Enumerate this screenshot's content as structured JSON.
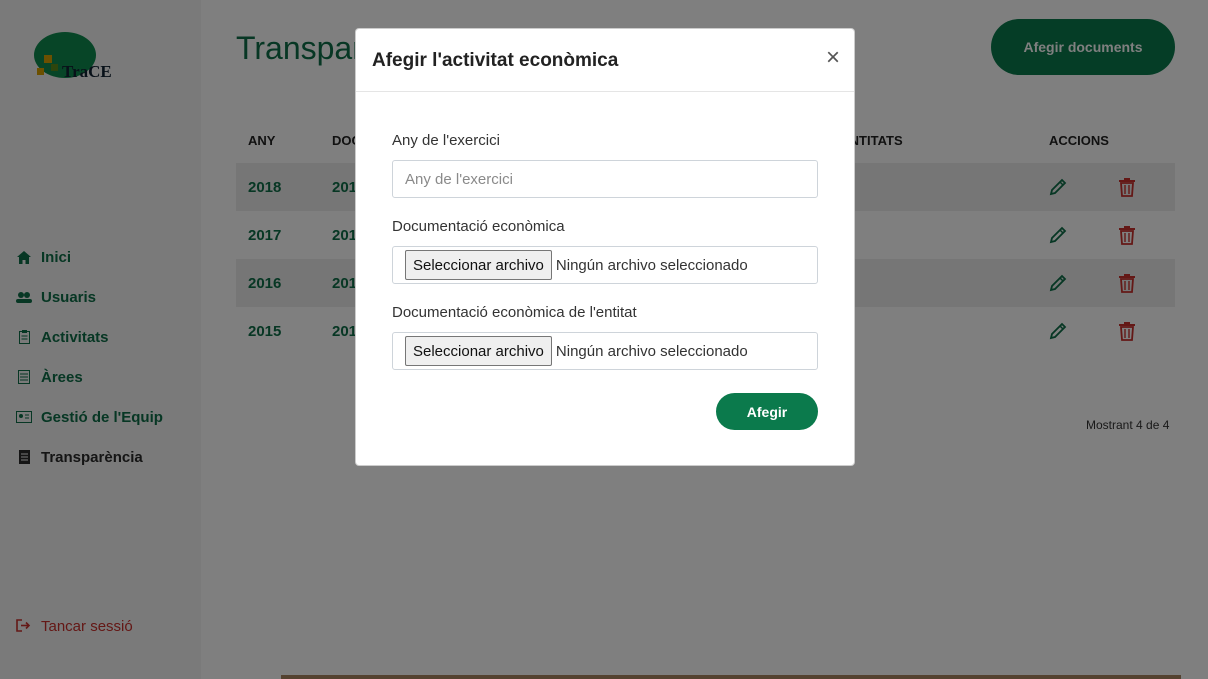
{
  "logo": {
    "text": "TraCE"
  },
  "nav": {
    "items": [
      {
        "label": "Inici",
        "icon": "home-icon"
      },
      {
        "label": "Usuaris",
        "icon": "users-icon"
      },
      {
        "label": "Activitats",
        "icon": "clipboard-icon"
      },
      {
        "label": "Àrees",
        "icon": "grid-icon"
      },
      {
        "label": "Gestió de l'Equip",
        "icon": "id-card-icon"
      },
      {
        "label": "Transparència",
        "icon": "document-icon",
        "active": true
      }
    ],
    "logout": "Tancar sessió"
  },
  "page": {
    "title": "Transparència",
    "add_button": "Afegir documents",
    "columns": [
      "ANY",
      "DOCUMENTACIÓ",
      "ENTITATS",
      "ACCIONS"
    ],
    "rows": [
      {
        "year": "2018",
        "doc": "2018"
      },
      {
        "year": "2017",
        "doc": "2017"
      },
      {
        "year": "2016",
        "doc": "2016"
      },
      {
        "year": "2015",
        "doc": "2015"
      }
    ],
    "showing": "Mostrant 4 de 4"
  },
  "modal": {
    "title": "Afegir l'activitat econòmica",
    "close": "×",
    "field1_label": "Any de l'exercici",
    "field1_placeholder": "Any de l'exercici",
    "field2_label": "Documentació econòmica",
    "field3_label": "Documentació econòmica de l'entitat",
    "file_button": "Seleccionar archivo",
    "file_none": "Ningún archivo seleccionado",
    "submit": "Afegir"
  },
  "colors": {
    "primary": "#0b7a4c",
    "danger": "#c9302c"
  }
}
